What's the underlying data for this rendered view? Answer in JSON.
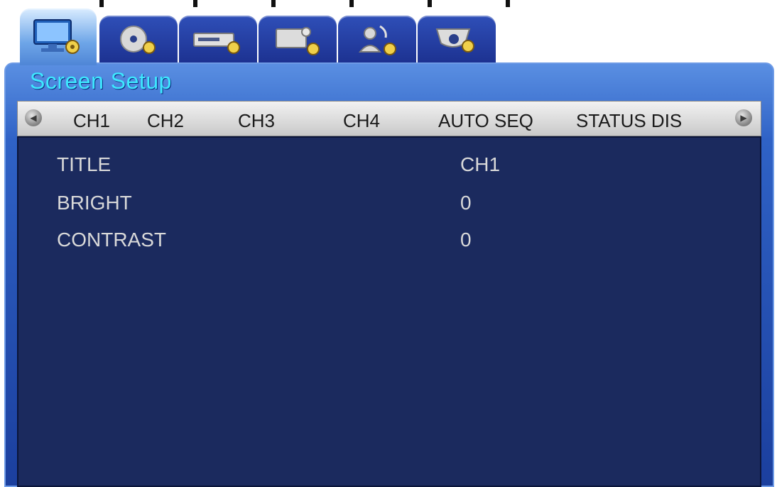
{
  "window": {
    "title": "Screen Setup"
  },
  "tabs": [
    {
      "icon": "monitor-gear-icon",
      "active": true
    },
    {
      "icon": "disc-gear-icon",
      "active": false
    },
    {
      "icon": "recorder-gear-icon",
      "active": false
    },
    {
      "icon": "monitor-camera-gear-icon",
      "active": false
    },
    {
      "icon": "network-user-gear-icon",
      "active": false
    },
    {
      "icon": "dome-camera-gear-icon",
      "active": false
    }
  ],
  "navbar": {
    "left_arrow_icon": "arrow-left-icon",
    "right_arrow_icon": "arrow-right-icon",
    "items": [
      "CH1",
      "CH2",
      "CH3",
      "CH4",
      "AUTO SEQ",
      "STATUS DIS"
    ]
  },
  "settings": [
    {
      "label": "TITLE",
      "value": "CH1"
    },
    {
      "label": "BRIGHT",
      "value": "0"
    },
    {
      "label": "CONTRAST",
      "value": "0"
    }
  ],
  "colors": {
    "title": "#3ee8ff",
    "panel": "#1b2a5e",
    "window": "#2f62c6"
  }
}
